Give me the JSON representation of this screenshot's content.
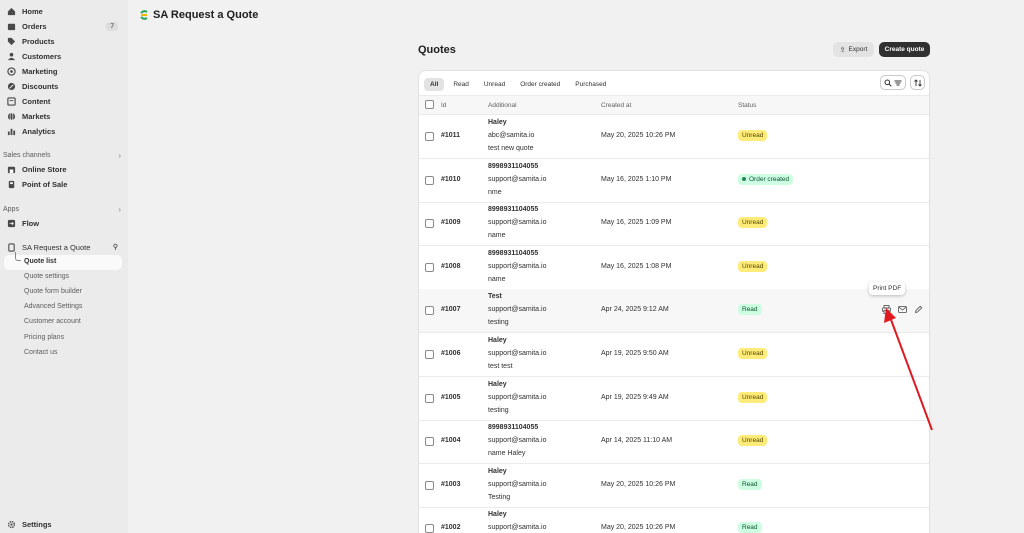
{
  "sidebar": {
    "nav": [
      {
        "label": "Home",
        "icon": "home-icon"
      },
      {
        "label": "Orders",
        "icon": "orders-icon",
        "count": "7"
      },
      {
        "label": "Products",
        "icon": "tag-icon"
      },
      {
        "label": "Customers",
        "icon": "person-icon"
      },
      {
        "label": "Marketing",
        "icon": "target-icon"
      },
      {
        "label": "Discounts",
        "icon": "discount-icon"
      },
      {
        "label": "Content",
        "icon": "content-icon"
      },
      {
        "label": "Markets",
        "icon": "globe-icon"
      },
      {
        "label": "Analytics",
        "icon": "chart-icon"
      }
    ],
    "sales_channels_label": "Sales channels",
    "channels": [
      {
        "label": "Online Store",
        "icon": "store-icon"
      },
      {
        "label": "Point of Sale",
        "icon": "pos-icon"
      }
    ],
    "apps_label": "Apps",
    "apps": [
      {
        "label": "Flow",
        "icon": "flow-icon"
      }
    ],
    "app_name": "SA Request a Quote",
    "app_subitems": [
      "Quote list",
      "Quote settings",
      "Quote form builder",
      "Advanced Settings",
      "Customer account",
      "Pricing plans",
      "Contact us"
    ],
    "settings_label": "Settings"
  },
  "header": {
    "app_title": "SA Request a Quote"
  },
  "page": {
    "title": "Quotes",
    "export_label": "Export",
    "create_label": "Create quote"
  },
  "tabs": [
    "All",
    "Read",
    "Unread",
    "Order created",
    "Purchased"
  ],
  "columns": {
    "id": "Id",
    "additional": "Additional",
    "created_at": "Created at",
    "status": "Status"
  },
  "rows": [
    {
      "id": "#1011",
      "l1": "Haley",
      "l2": "abc@samita.io",
      "l3": "test new quote",
      "date": "May 20, 2025 10:26 PM",
      "status": "Unread"
    },
    {
      "id": "#1010",
      "l1": "8998931104055",
      "l2": "support@samita.io",
      "l3": "nme",
      "date": "May 16, 2025 1:10 PM",
      "status": "Order created"
    },
    {
      "id": "#1009",
      "l1": "8998931104055",
      "l2": "support@samita.io",
      "l3": "name",
      "date": "May 16, 2025 1:09 PM",
      "status": "Unread"
    },
    {
      "id": "#1008",
      "l1": "8998931104055",
      "l2": "support@samita.io",
      "l3": "name",
      "date": "May 16, 2025 1:08 PM",
      "status": "Unread"
    },
    {
      "id": "#1007",
      "l1": "Test",
      "l2": "support@samita.io",
      "l3": "testing",
      "date": "Apr 24, 2025 9:12 AM",
      "status": "Read"
    },
    {
      "id": "#1006",
      "l1": "Haley",
      "l2": "support@samita.io",
      "l3": "test test",
      "date": "Apr 19, 2025 9:50 AM",
      "status": "Unread"
    },
    {
      "id": "#1005",
      "l1": "Haley",
      "l2": "support@samita.io",
      "l3": "testing",
      "date": "Apr 19, 2025 9:49 AM",
      "status": "Unread"
    },
    {
      "id": "#1004",
      "l1": "8998931104055",
      "l2": "support@samita.io",
      "l3": "name Haley",
      "date": "Apr 14, 2025 11:10 AM",
      "status": "Unread"
    },
    {
      "id": "#1003",
      "l1": "Haley",
      "l2": "support@samita.io",
      "l3": "Testing",
      "date": "May 20, 2025 10:26 PM",
      "status": "Read"
    },
    {
      "id": "#1002",
      "l1": "Haley",
      "l2": "support@samita.io",
      "l3": "",
      "date": "May 20, 2025 10:26 PM",
      "status": "Read"
    }
  ],
  "tooltip": "Print PDF",
  "colors": {
    "annotation_arrow": "#e0191f",
    "unread_badge": "#ffeb78",
    "read_badge": "#cdfee1"
  }
}
